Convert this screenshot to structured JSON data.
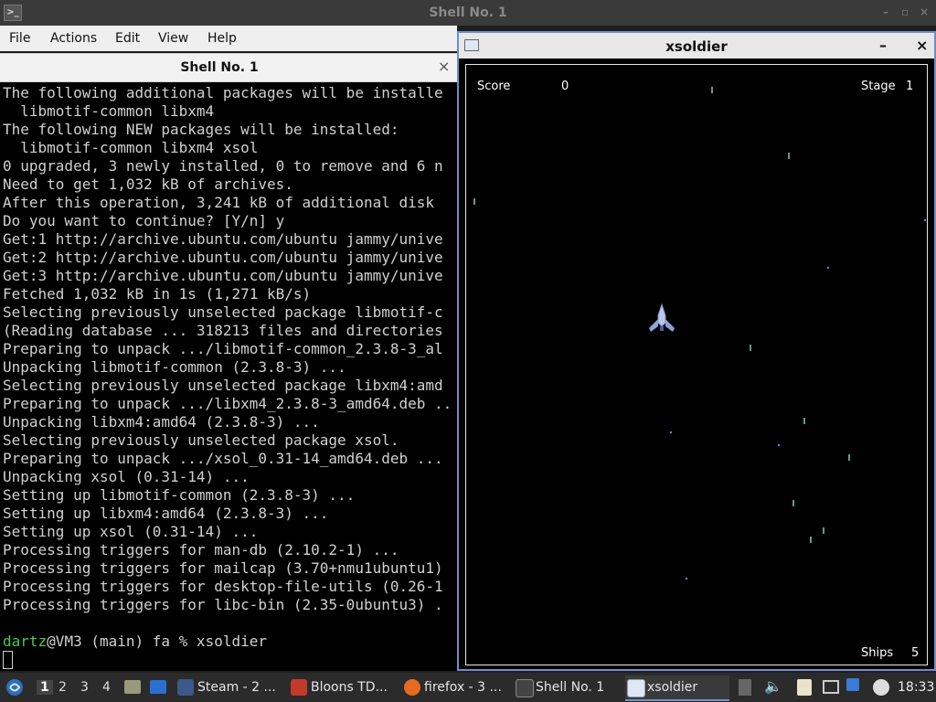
{
  "terminal": {
    "window_title": "Shell No. 1",
    "menu": [
      "File",
      "Actions",
      "Edit",
      "View",
      "Help"
    ],
    "tab_label": "Shell No. 1",
    "lines": [
      "The following additional packages will be installe",
      "  libmotif-common libxm4",
      "The following NEW packages will be installed:",
      "  libmotif-common libxm4 xsol",
      "0 upgraded, 3 newly installed, 0 to remove and 6 n",
      "Need to get 1,032 kB of archives.",
      "After this operation, 3,241 kB of additional disk ",
      "Do you want to continue? [Y/n] y",
      "Get:1 http://archive.ubuntu.com/ubuntu jammy/unive",
      "Get:2 http://archive.ubuntu.com/ubuntu jammy/unive",
      "Get:3 http://archive.ubuntu.com/ubuntu jammy/unive",
      "Fetched 1,032 kB in 1s (1,271 kB/s)",
      "Selecting previously unselected package libmotif-c",
      "(Reading database ... 318213 files and directories",
      "Preparing to unpack .../libmotif-common_2.3.8-3_al",
      "Unpacking libmotif-common (2.3.8-3) ...",
      "Selecting previously unselected package libxm4:amd",
      "Preparing to unpack .../libxm4_2.3.8-3_amd64.deb ..",
      "Unpacking libxm4:amd64 (2.3.8-3) ...",
      "Selecting previously unselected package xsol.",
      "Preparing to unpack .../xsol_0.31-14_amd64.deb ...",
      "Unpacking xsol (0.31-14) ...",
      "Setting up libmotif-common (2.3.8-3) ...",
      "Setting up libxm4:amd64 (2.3.8-3) ...",
      "Setting up xsol (0.31-14) ...",
      "Processing triggers for man-db (2.10.2-1) ...",
      "Processing triggers for mailcap (3.70+nmu1ubuntu1)",
      "Processing triggers for desktop-file-utils (0.26-1",
      "Processing triggers for libc-bin (2.35-0ubuntu3) .",
      ""
    ],
    "prompt": {
      "user": "dartz",
      "rest": "@VM3 (main) fa % xsoldier"
    }
  },
  "game": {
    "window_title": "xsoldier",
    "minimize_label": "–",
    "close_label": "×",
    "score_label": "Score",
    "score_value": "0",
    "stage_label": "Stage",
    "stage_value": "1",
    "ships_label": "Ships",
    "ships_value": "5"
  },
  "taskbar": {
    "workspaces": [
      "1",
      "2",
      "3",
      "4"
    ],
    "active_workspace": "1",
    "tasks": [
      {
        "label": "Steam - 2 ...",
        "icon": "steam-icon",
        "color": "#3b5a85"
      },
      {
        "label": "Bloons TD...",
        "icon": "bloons-icon",
        "color": "#c23a2b"
      },
      {
        "label": "firefox - 3 ...",
        "icon": "firefox-icon",
        "color": "#e66a1f"
      },
      {
        "label": "Shell No. 1",
        "icon": "terminal-icon",
        "color": "#444444"
      },
      {
        "label": "xsoldier",
        "icon": "window-icon",
        "color": "#dde7f5"
      }
    ],
    "clock": "18:33"
  }
}
